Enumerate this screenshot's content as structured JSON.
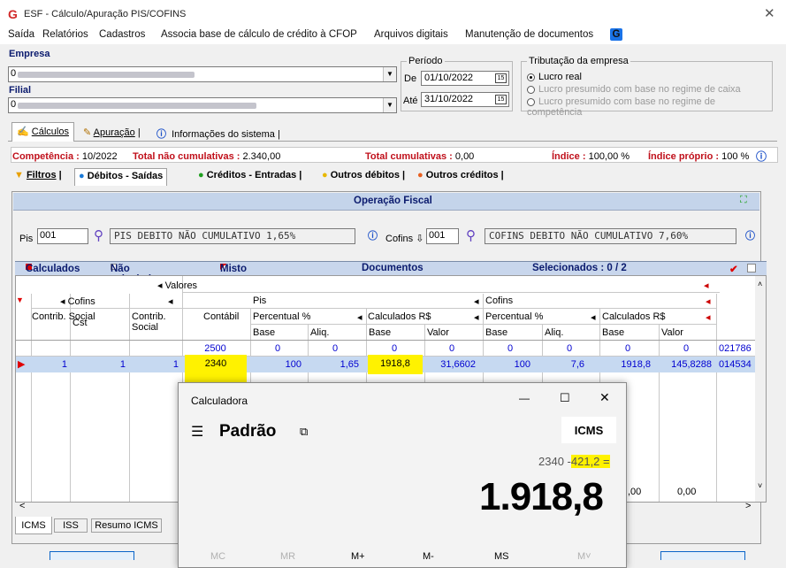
{
  "window": {
    "logo": "G",
    "title": "ESF - Cálculo/Apuração PIS/COFINS",
    "close": "✕"
  },
  "menu": [
    "Saída",
    "Relatórios",
    "Cadastros",
    "Associa base de cálculo de crédito à CFOP",
    "Arquivos digitais",
    "Manutenção de documentos",
    "G"
  ],
  "empresa": {
    "label": "Empresa",
    "value": "0",
    "blurred": true
  },
  "filial": {
    "label": "Filial",
    "value": "0",
    "blurred": true
  },
  "periodo": {
    "title": "Período",
    "de_label": "De",
    "de_value": "01/10/2022",
    "ate_label": "Até",
    "ate_value": "31/10/2022",
    "cal_icon": "15"
  },
  "tributacao": {
    "title": "Tributação da empresa",
    "options": [
      "Lucro real",
      "Lucro presumido com base no regime de caixa",
      "Lucro presumido com base no regime de competência"
    ],
    "selected": "Lucro real"
  },
  "main_tabs": [
    "Cálculos",
    "Apuração",
    "Informações do sistema"
  ],
  "status": {
    "competencia_label": "Competência :",
    "competencia": "10/2022",
    "nao_cumul_label": "Total não cumulativas :",
    "nao_cumul": "2.340,00",
    "cumul_label": "Total cumulativas :",
    "cumul": "0,00",
    "indice_label": "Índice :",
    "indice": "100,00 %",
    "indice_proprio_label": "Índice próprio :",
    "indice_proprio": "100 %"
  },
  "sub_tabs": [
    "Filtros",
    "Débitos - Saídas",
    "Créditos - Entradas",
    "Outros débitos",
    "Outros créditos"
  ],
  "operacao": {
    "header": "Operação Fiscal",
    "pis_label": "Pis",
    "pis_code": "001",
    "pis_desc": "PIS DEBITO NÃO CUMULATIVO 1,65%",
    "cofins_label": "Cofins",
    "cofins_code": "001",
    "cofins_desc": "COFINS DEBITO NÃO CUMULATIVO 7,60%"
  },
  "grid_bar": {
    "calculados": "Calculados",
    "nao_calculados": "Não calculados",
    "misto": "Misto",
    "documentos": "Documentos",
    "selecionados": "Selecionados : 0 / 2"
  },
  "grid": {
    "valores": "Valores",
    "cofins_group": "Cofins",
    "contrib_social": "Contrib. Social",
    "cst": "Cst",
    "contrib_social2": "Contrib. Social",
    "contabil": "Contábil",
    "pis": "Pis",
    "cofins": "Cofins",
    "percentual": "Percentual %",
    "calculados_rs": "Calculados R$",
    "percentual2": "Percentual %",
    "calculados_rs2": "Calculados R$",
    "base": "Base",
    "aliq": "Aliq.",
    "base2": "Base",
    "valor": "Valor",
    "base3": "Base",
    "aliq2": "Aliq.",
    "base4": "Base",
    "valor2": "Valor",
    "row1": [
      "2500",
      "0",
      "0",
      "0",
      "0",
      "0",
      "0",
      "0",
      "0",
      "021786"
    ],
    "row2": [
      "1",
      "1",
      "1",
      "2340",
      "100",
      "1,65",
      "1918,8",
      "31,6602",
      "100",
      "7,6",
      "1918,8",
      "145,8288",
      "014534"
    ],
    "footer": [
      ",00",
      "0,00"
    ]
  },
  "bottom_tabs": [
    "ICMS",
    "ISS",
    "Resumo ICMS"
  ],
  "calculator": {
    "title": "Calculadora",
    "mode": "Padrão",
    "memory_button": "ICMS",
    "expression_prefix": "2340 -",
    "expression_hl": "421,2 =",
    "display": "1.918,8",
    "mem_buttons": [
      "MC",
      "MR",
      "M+",
      "M-",
      "MS",
      "M˅"
    ],
    "win_buttons": [
      "—",
      "☐",
      "✕"
    ]
  },
  "colors": {
    "accent": "#0b1b6e",
    "red": "#c0101b",
    "highlight": "#fff200",
    "selected_row": "#c6d9f1"
  }
}
